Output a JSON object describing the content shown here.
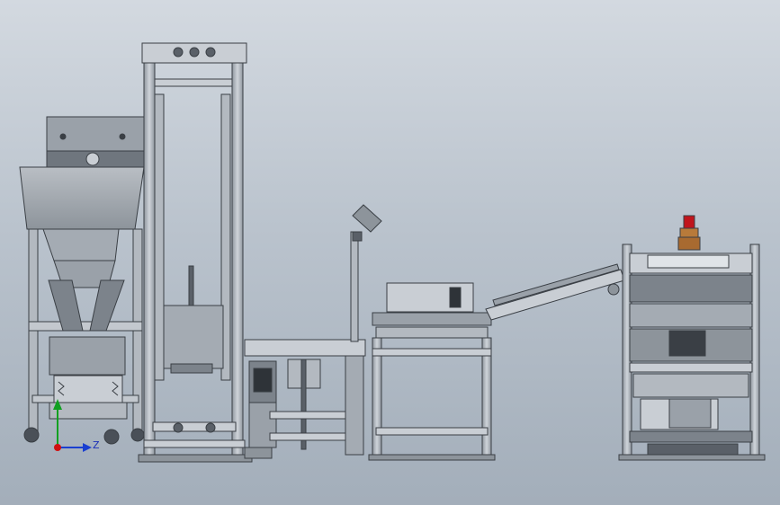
{
  "viewport": {
    "background_top": "#d3d9e0",
    "background_bottom": "#a3aeba"
  },
  "triad": {
    "axis_x_label": "Z",
    "axis_x_color": "#1a3fd0",
    "axis_y_color": "#10a020",
    "origin_color": "#d01010"
  },
  "colors": {
    "steel_light": "#c9ced4",
    "steel_mid": "#a9b0b8",
    "steel_dark": "#6d747c",
    "outline": "#3a3f45",
    "beacon_red": "#c0141c",
    "beacon_amber": "#b87a3a"
  }
}
